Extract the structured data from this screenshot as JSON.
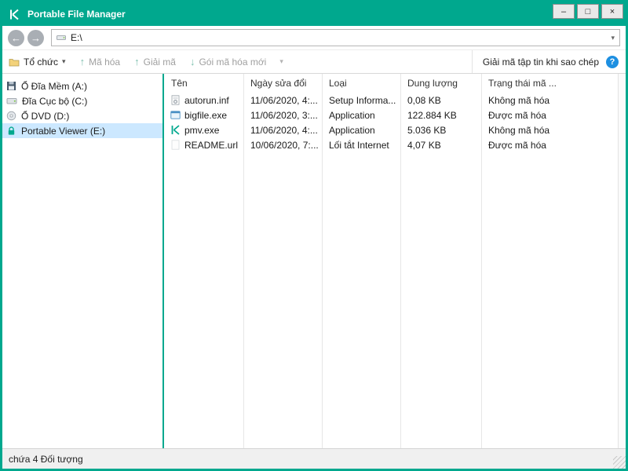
{
  "window": {
    "title": "Portable File Manager",
    "controls": {
      "minimize": "–",
      "maximize": "□",
      "close": "×"
    }
  },
  "navbar": {
    "address": "E:\\"
  },
  "icons": {
    "back": "←",
    "forward": "→",
    "caret_down": "▾",
    "up_arrow": "↑",
    "down_arrow": "↓",
    "help": "?"
  },
  "toolbar": {
    "organize": "Tổ chức",
    "encrypt": "Mã hóa",
    "decrypt": "Giải mã",
    "new_package": "Gói mã hóa mới",
    "decrypt_on_copy": "Giải mã tập tin khi sao chép"
  },
  "sidebar": {
    "items": [
      {
        "label": "Ổ Đĩa Mềm (A:)"
      },
      {
        "label": "Đĩa Cục bộ (C:)"
      },
      {
        "label": "Ổ DVD (D:)"
      },
      {
        "label": "Portable Viewer (E:)",
        "selected": true
      }
    ]
  },
  "filelist": {
    "columns": [
      "Tên",
      "Ngày sửa đổi",
      "Loại",
      "Dung lượng",
      "Trạng thái mã ..."
    ],
    "rows": [
      {
        "name": "autorun.inf",
        "modified": "11/06/2020, 4:...",
        "type": "Setup Informa...",
        "size": "0,08 KB",
        "status": "Không mã hóa"
      },
      {
        "name": "bigfile.exe",
        "modified": "11/06/2020, 3:...",
        "type": "Application",
        "size": "122.884 KB",
        "status": "Được mã hóa"
      },
      {
        "name": "pmv.exe",
        "modified": "11/06/2020, 4:...",
        "type": "Application",
        "size": "5.036 KB",
        "status": "Không mã hóa"
      },
      {
        "name": "README.url",
        "modified": "10/06/2020, 7:...",
        "type": "Lối tắt Internet",
        "size": "4,07 KB",
        "status": "Được mã hóa"
      }
    ]
  },
  "statusbar": {
    "text": "chứa 4 Đối tượng"
  },
  "colors": {
    "accent": "#00a88e",
    "selection": "#cce8ff",
    "help_blue": "#1d8fe1"
  }
}
